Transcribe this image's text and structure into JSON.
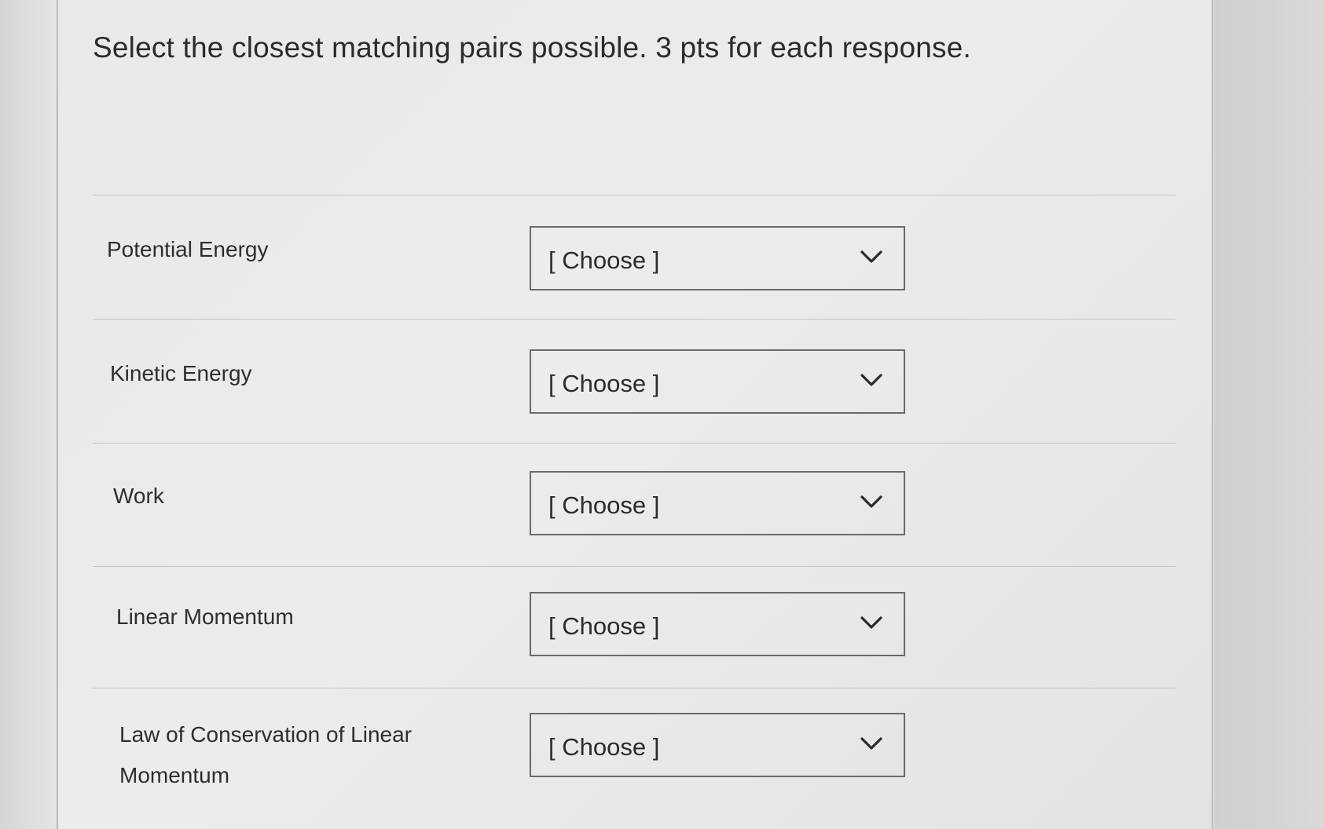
{
  "question": {
    "title": "Select the closest matching pairs possible.  3 pts for each response."
  },
  "pairs": [
    {
      "prompt": "Potential Energy",
      "selected": "[ Choose ]"
    },
    {
      "prompt": "Kinetic Energy",
      "selected": "[ Choose ]"
    },
    {
      "prompt": "Work",
      "selected": "[ Choose ]"
    },
    {
      "prompt": "Linear Momentum",
      "selected": "[ Choose ]"
    },
    {
      "prompt": "Law of Conservation of Linear Momentum",
      "selected": "[ Choose ]"
    }
  ],
  "icons": {
    "dropdown": "chevron-down-icon"
  },
  "colors": {
    "text": "#2b2b2b",
    "border": "#6a6a6a",
    "divider": "#c4c4c4"
  }
}
